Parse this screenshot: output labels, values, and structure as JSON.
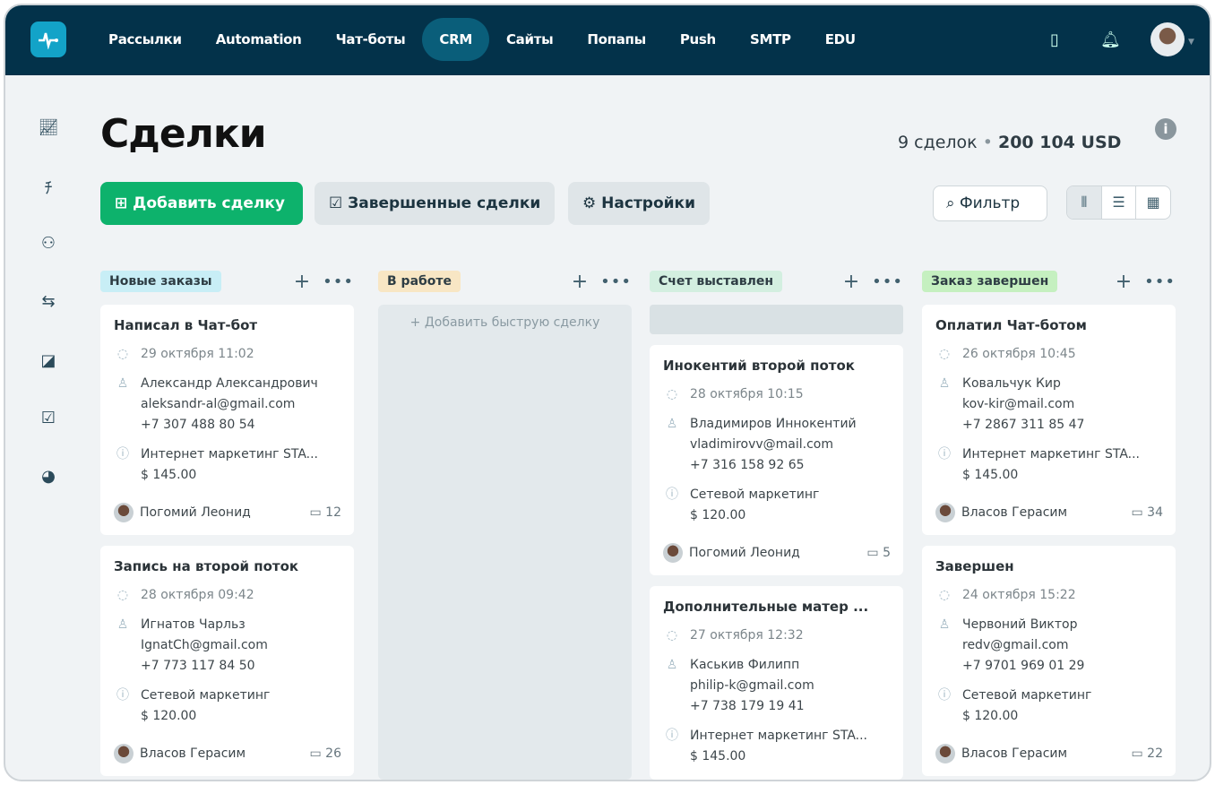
{
  "nav": {
    "items": [
      "Рассылки",
      "Automation",
      "Чат-боты",
      "CRM",
      "Сайты",
      "Попапы",
      "Push",
      "SMTP",
      "EDU"
    ],
    "active": "CRM"
  },
  "page": {
    "title": "Сделки",
    "count": "9 сделок",
    "total": "200 104 USD",
    "sep": "•"
  },
  "toolbar": {
    "add": "Добавить сделку",
    "done": "Завершенные сделки",
    "settings": "Настройки",
    "filter": "Фильтр"
  },
  "colors": {
    "header": "#03324a",
    "accent": "#0db26c"
  },
  "columns": [
    {
      "title": "Новые заказы",
      "color": "#c8eef6",
      "cards": [
        {
          "title": "Написал в Чат-бот",
          "date": "29 октября 11:02",
          "name": "Александр Александрович",
          "email": "aleksandr-al@gmail.com",
          "phone": "+7 307 488 80 54",
          "product": "Интернет маркетинг STA...",
          "price": "$ 145.00",
          "owner": "Погомий Леонид",
          "comments": "12"
        },
        {
          "title": "Запись на второй поток",
          "date": "28 октября 09:42",
          "name": "Игнатов Чарльз",
          "email": "IgnatCh@gmail.com",
          "phone": "+7 773 117 84 50",
          "product": "Сетевой маркетинг",
          "price": "$ 120.00",
          "owner": "Власов Герасим",
          "comments": "26"
        }
      ]
    },
    {
      "title": "В работе",
      "color": "#f8e6c4",
      "quick": "Добавить быструю сделку",
      "cards": []
    },
    {
      "title": "Счет выставлен",
      "color": "#d3efe0",
      "placeholder": true,
      "cards": [
        {
          "title": "Инокентий второй поток",
          "date": "28 октября 10:15",
          "name": "Владимиров Иннокентий",
          "email": "vladimirovv@mail.com",
          "phone": "+7 316 158 92 65",
          "product": "Сетевой маркетинг",
          "price": "$ 120.00",
          "owner": "Погомий Леонид",
          "comments": "5"
        },
        {
          "title": "Дополнительные матер ...",
          "date": "27 октября 12:32",
          "name": "Каськив Филипп",
          "email": "philip-k@gmail.com",
          "phone": "+7 738 179 19 41",
          "product": "Интернет маркетинг STA...",
          "price": "$ 145.00",
          "owner": "",
          "comments": ""
        }
      ]
    },
    {
      "title": "Заказ завершен",
      "color": "#c5f0c0",
      "cards": [
        {
          "title": "Оплатил Чат-ботом",
          "date": "26 октября 10:45",
          "name": "Ковальчук Кир",
          "email": "kov-kir@mail.com",
          "phone": "+7 2867 311 85 47",
          "product": "Интернет маркетинг STA...",
          "price": "$ 145.00",
          "owner": "Власов Герасим",
          "comments": "34"
        },
        {
          "title": "Завершен",
          "date": "24 октября 15:22",
          "name": "Червоний Виктор",
          "email": "redv@gmail.com",
          "phone": "+7 9701 969 01 29",
          "product": "Сетевой маркетинг",
          "price": "$ 120.00",
          "owner": "Власов Герасим",
          "comments": "22"
        }
      ]
    }
  ]
}
